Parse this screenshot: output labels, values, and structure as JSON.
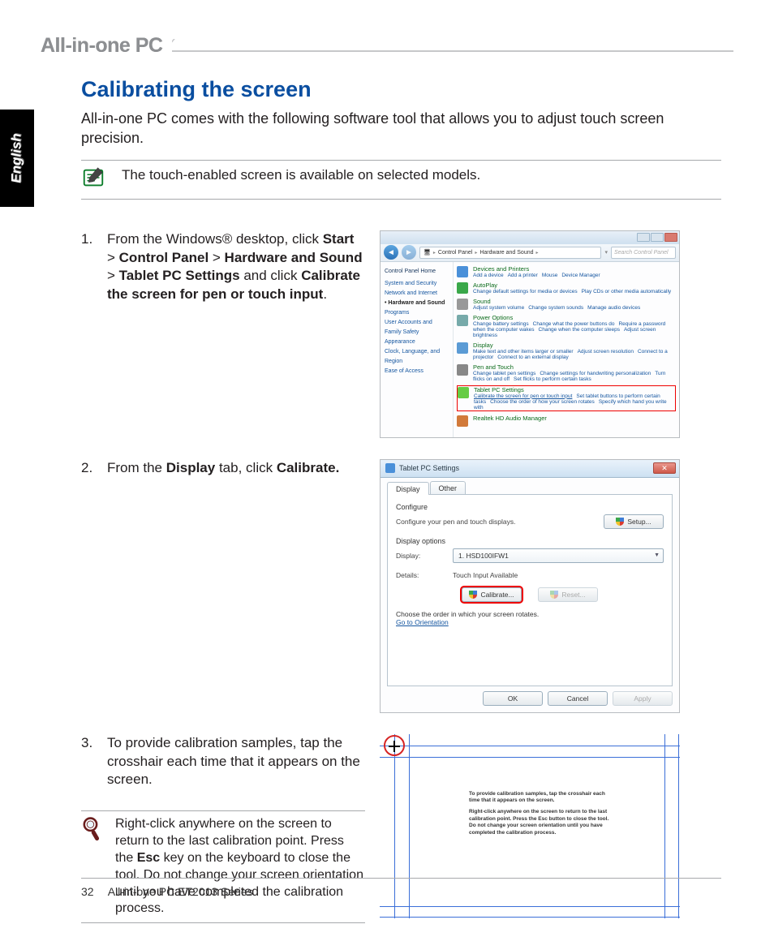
{
  "language_tab": "English",
  "header": "All-in-one PC",
  "section_title": "Calibrating the screen",
  "intro": "All-in-one PC comes with the following software tool that allows you to adjust touch screen precision.",
  "note": "The touch-enabled screen is available on selected models.",
  "step1": {
    "num": "1.",
    "prefix": "From the Windows® desktop, click ",
    "b1": "Start",
    "sep1": " > ",
    "b2": "Control Panel",
    "sep2": " > ",
    "b3": "Hardware and Sound",
    "sep3": " > ",
    "b4": "Tablet PC Settings",
    "mid": " and click ",
    "b5": "Calibrate the screen for pen or touch input",
    "end": "."
  },
  "cp": {
    "breadcrumb": {
      "root": "Control Panel",
      "sub": "Hardware and Sound"
    },
    "search_placeholder": "Search Control Panel",
    "sidebar_header": "Control Panel Home",
    "sidebar": [
      "System and Security",
      "Network and Internet",
      "Hardware and Sound",
      "Programs",
      "User Accounts and Family Safety",
      "Appearance",
      "Clock, Language, and Region",
      "Ease of Access"
    ],
    "items": [
      {
        "cat": "Devices and Printers",
        "links": [
          "Add a device",
          "Add a printer",
          "Mouse",
          "Device Manager"
        ]
      },
      {
        "cat": "AutoPlay",
        "links": [
          "Change default settings for media or devices",
          "Play CDs or other media automatically"
        ]
      },
      {
        "cat": "Sound",
        "links": [
          "Adjust system volume",
          "Change system sounds",
          "Manage audio devices"
        ]
      },
      {
        "cat": "Power Options",
        "links": [
          "Change battery settings",
          "Change what the power buttons do",
          "Require a password when the computer wakes",
          "Change when the computer sleeps",
          "Adjust screen brightness"
        ]
      },
      {
        "cat": "Display",
        "links": [
          "Make text and other items larger or smaller",
          "Adjust screen resolution",
          "Connect to a projector",
          "Connect to an external display"
        ]
      },
      {
        "cat": "Pen and Touch",
        "links": [
          "Change tablet pen settings",
          "Change settings for handwriting personalization",
          "Turn flicks on and off",
          "Set flicks to perform certain tasks"
        ]
      },
      {
        "cat": "Tablet PC Settings",
        "links": [
          "Calibrate the screen for pen or touch input",
          "Set tablet buttons to perform certain tasks",
          "Choose the order of how your screen rotates",
          "Specify which hand you write with"
        ]
      },
      {
        "cat": "Realtek HD Audio Manager",
        "links": []
      }
    ]
  },
  "step2": {
    "num": "2.",
    "prefix": "From the ",
    "b1": "Display",
    "mid": " tab, click ",
    "b2": "Calibrate."
  },
  "dlg": {
    "title": "Tablet PC Settings",
    "tab_display": "Display",
    "tab_other": "Other",
    "configure": "Configure",
    "configure_desc": "Configure your pen and touch displays.",
    "setup_btn": "Setup...",
    "display_options": "Display options",
    "display_label": "Display:",
    "display_value": "1. HSD100IFW1",
    "details_label": "Details:",
    "details_value": "Touch Input Available",
    "calibrate_btn": "Calibrate...",
    "reset_btn": "Reset...",
    "rotate_text": "Choose the order in which your screen rotates.",
    "goto_orientation": "Go to Orientation",
    "ok": "OK",
    "cancel": "Cancel",
    "apply": "Apply"
  },
  "step3": {
    "num": "3.",
    "text": "To provide calibration samples, tap the crosshair each time that it appears on the screen."
  },
  "calib_overlay": {
    "l1": "To provide calibration samples, tap the crosshair each time that it appears on the screen.",
    "l2": "Right-click anywhere on the screen to return to the last calibration point. Press the Esc button to close the tool. Do not change your screen orientation until you have completed the calibration process."
  },
  "tip": {
    "prefix": "Right-click anywhere on the screen to return to the last calibration point. Press the ",
    "b1": "Esc",
    "suffix": " key on the keyboard to close the tool. Do not change your screen orientation until you have completed the calibration process."
  },
  "footer": {
    "page": "32",
    "series": "All-in-one PC ET2013 Series"
  }
}
